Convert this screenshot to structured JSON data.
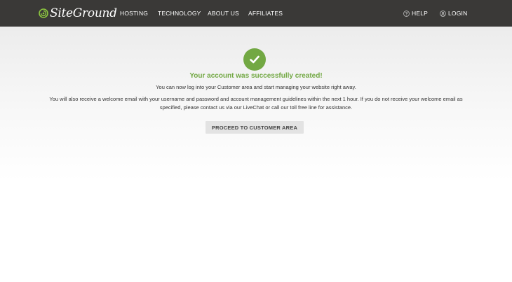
{
  "header": {
    "logo_text": "SiteGround",
    "nav": [
      {
        "label": "HOSTING"
      },
      {
        "label": "TECHNOLOGY"
      },
      {
        "label": "ABOUT US"
      },
      {
        "label": "AFFILIATES"
      }
    ],
    "help_label": "HELP",
    "login_label": "LOGIN"
  },
  "main": {
    "icon": "checkmark-icon",
    "headline": "Your account was successfully created!",
    "line1": "You can now log into your Customer area and start managing your website right away.",
    "paragraph": "You will also receive a welcome email with your username and password and account management guidelines within the next 1 hour. If you do not receive your welcome email as specified, please contact us via our LiveChat or call our toll free line for assistance.",
    "cta_label": "PROCEED TO CUSTOMER AREA"
  },
  "colors": {
    "header_bg": "#3a3937",
    "accent_green": "#72a843",
    "button_bg": "#e3e3e3"
  }
}
